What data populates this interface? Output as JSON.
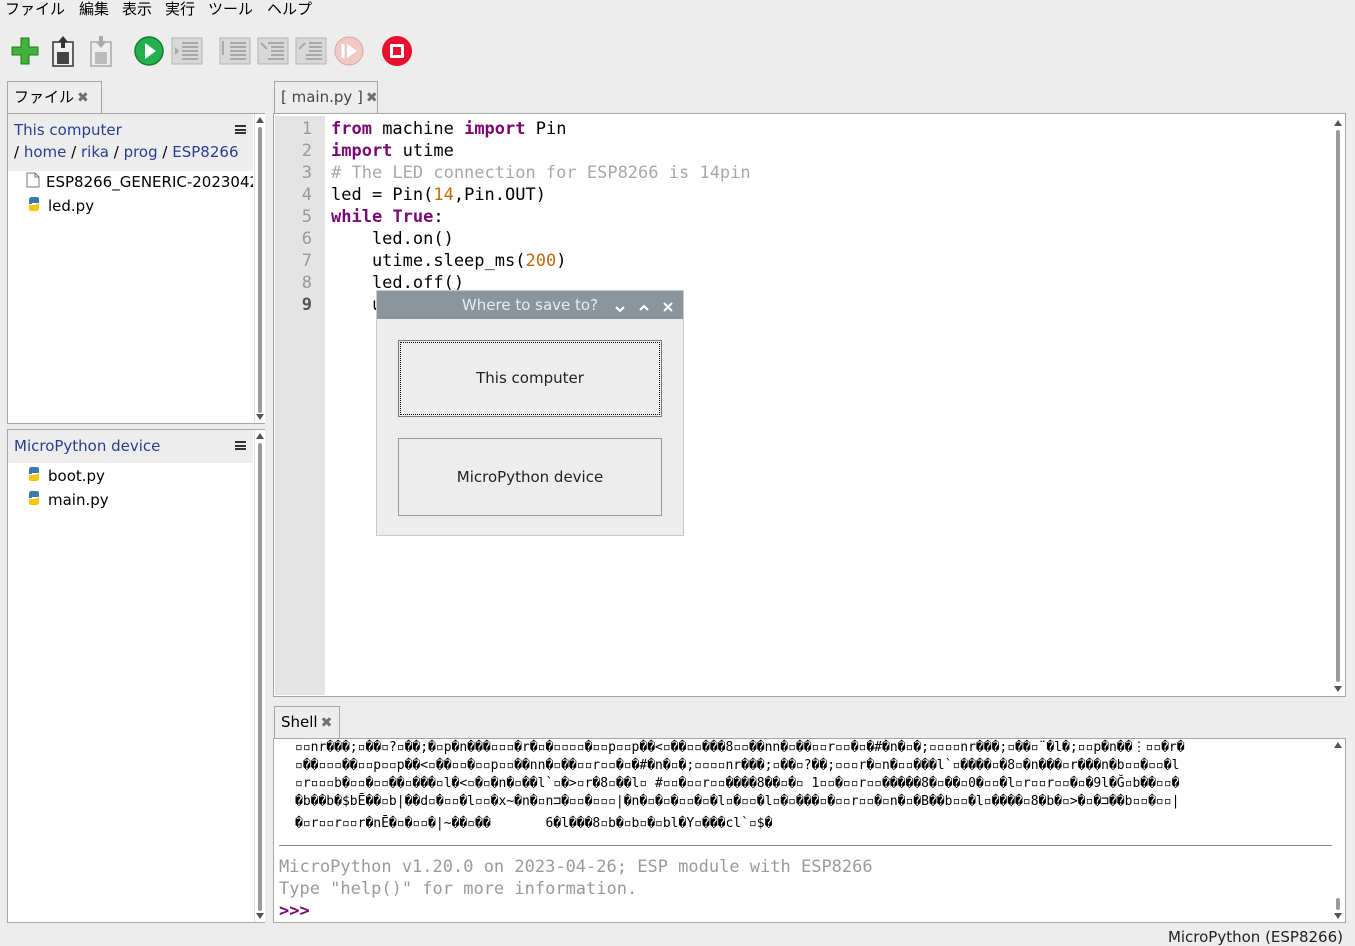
{
  "menu": [
    "ファイル",
    "編集",
    "表示",
    "実行",
    "ツール",
    "ヘルプ"
  ],
  "toolbar": {
    "buttons": [
      "new-file",
      "open-file",
      "save-file",
      "run",
      "debug",
      "step-over",
      "step-into",
      "step-out",
      "resume",
      "stop"
    ]
  },
  "files_tab": {
    "label": "ファイル",
    "close": "✖"
  },
  "this_computer": {
    "title": "This computer",
    "breadcrumb": [
      "home",
      "rika",
      "prog",
      "ESP8266"
    ],
    "separator": "/",
    "files": [
      {
        "name": "ESP8266_GENERIC-2023042",
        "type": "file"
      },
      {
        "name": "led.py",
        "type": "python"
      }
    ]
  },
  "device": {
    "title": "MicroPython device",
    "files": [
      {
        "name": "boot.py",
        "type": "python"
      },
      {
        "name": "main.py",
        "type": "python"
      }
    ]
  },
  "editor_tab": {
    "label": "[ main.py ]",
    "close": "✖"
  },
  "editor": {
    "line_numbers": [
      "1",
      "2",
      "3",
      "4",
      "5",
      "6",
      "7",
      "8",
      "9"
    ],
    "current_line": "9"
  },
  "dialog": {
    "title": "Where to save to?",
    "option_computer": "This computer",
    "option_device": "MicroPython device"
  },
  "shell_tab": {
    "label": "Shell",
    "close": "✖"
  },
  "shell": {
    "garbled": [
      "▫▫nr���;▫��▫?▫��;�▫p�n���▫▫▫�r�▫�▫▫▫▫�▫▫p▫▫p��<▫��▫▫���8▫▫��nn�▫��▫▫r▫▫�▫�#�n�▫�;▫▫▫▫nr���;▫��▫¨�l�;▫▫p�n��⋮▫▫�r�",
      "▫��▫▫▫��▫▫p▫▫p��<▫��▫▫�▫▫p▫▫��nn�▫��▫▫r▫▫�▫�#�n�▫�;▫▫▫▫nr���;▫��▫?��;▫▫▫r�▫n�▫▫���l`▫����▫�8▫�n���▫r���n�b▫▫�▫▫�l",
      "▫r▫▫▫b�▫▫�▫▫��▫���▫l�<▫�▫�n�▫��l`▫�>▫r�8▫��l▫ #▫▫�▫▫r▫▫����8��▫�▫ 1▫▫�▫▫r▫▫�����8�▫��▫0�▫▫�l▫r▫▫r▫▫�▫�9l�Ğ▫b��▫▫�",
      "�b��b�$bĒ��▫b|��d▫�▫▫�l▫▫�x~�n�▫n⊐�▫▫�▫▫▫|�n�▫�▫�▫▫�▫�l▫�▫▫�l▫�▫���▫�▫▫r▫▫�▫n�▫�B��b▫▫�l▫����▫8�b�▫>�▫�⊐��b▫▫�▫▫|",
      "�▫r▫▫r▫▫r�nĒ�▫�▫▫�|~��▫��       6�l���8▫b�▫b▫�▫bl�Y▫���cl`▫$�"
    ],
    "banner": "MicroPython v1.20.0 on 2023-04-26; ESP module with ESP8266",
    "help_line": "Type \"help()\" for more information.",
    "prompt": ">>>"
  },
  "status": {
    "interpreter": "MicroPython (ESP8266)"
  },
  "colors": {
    "keyword": "#7a0874",
    "comment": "#a8a8a8",
    "number": "#c16a0a",
    "link": "#2a3e8f",
    "prompt": "#7a0874"
  }
}
